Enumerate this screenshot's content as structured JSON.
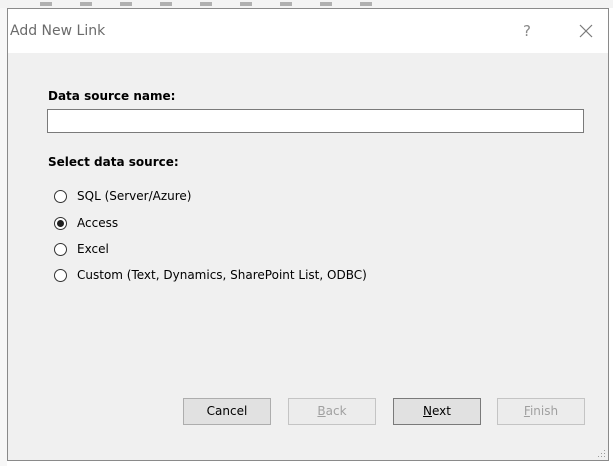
{
  "dialog": {
    "title": "Add New Link",
    "help_glyph": "?",
    "close_icon": "close-icon"
  },
  "form": {
    "name_label": "Data source name:",
    "name_value": "",
    "source_label": "Select data source:",
    "options": [
      {
        "label": "SQL (Server/Azure)",
        "checked": false
      },
      {
        "label": "Access",
        "checked": true
      },
      {
        "label": "Excel",
        "checked": false
      },
      {
        "label": "Custom (Text, Dynamics, SharePoint List, ODBC)",
        "checked": false
      }
    ]
  },
  "buttons": {
    "cancel": {
      "label": "Cancel",
      "enabled": true
    },
    "back": {
      "mnemonic": "B",
      "rest": "ack",
      "enabled": false
    },
    "next": {
      "mnemonic": "N",
      "rest": "ext",
      "enabled": true
    },
    "finish": {
      "mnemonic": "F",
      "rest": "inish",
      "enabled": false
    }
  },
  "colors": {
    "dialog_bg": "#f0f0f0",
    "titlebar_bg": "#ffffff",
    "border": "#8a8a8a"
  }
}
